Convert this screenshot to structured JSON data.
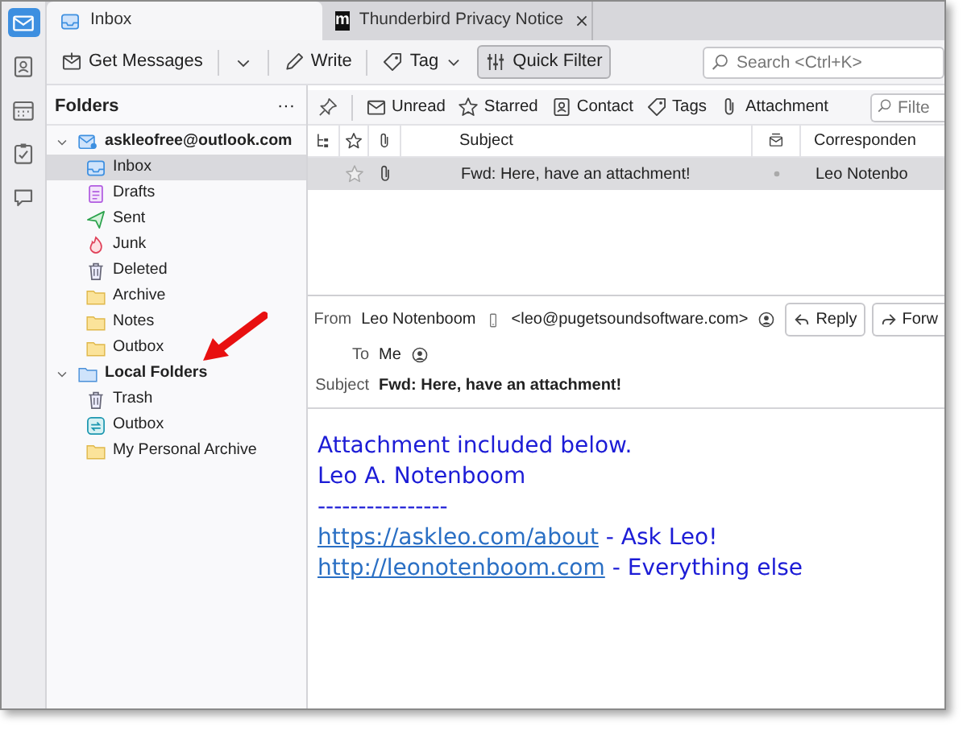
{
  "spaces": [
    {
      "kind": "mail",
      "selected": true
    },
    {
      "kind": "contacts",
      "selected": false
    },
    {
      "kind": "calendar",
      "selected": false
    },
    {
      "kind": "tasks",
      "selected": false
    },
    {
      "kind": "chat",
      "selected": false
    }
  ],
  "tabs": [
    {
      "label": "Inbox",
      "kind": "folder",
      "selected": true,
      "closable": false
    },
    {
      "label": "Thunderbird Privacy Notice",
      "kind": "site",
      "favicon": "m",
      "selected": false,
      "closable": true
    }
  ],
  "toolbar": [
    {
      "kind": "get",
      "label": "Get Messages"
    },
    {
      "kind": "caret"
    },
    {
      "kind": "write",
      "label": "Write"
    },
    {
      "kind": "tag",
      "label": "Tag"
    },
    {
      "kind": "filter",
      "label": "Quick Filter",
      "selected": true
    }
  ],
  "search": {
    "placeholder": "Search <Ctrl+K>"
  },
  "folder_pane": {
    "title": "Folders",
    "menu": "···"
  },
  "accounts": [
    {
      "name": "askleofree@outlook.com",
      "kind": "account",
      "expanded": true,
      "children": [
        {
          "name": "Inbox",
          "kind": "inbox",
          "selected": true
        },
        {
          "name": "Drafts",
          "kind": "drafts",
          "selected": false
        },
        {
          "name": "Sent",
          "kind": "sent",
          "selected": false
        },
        {
          "name": "Junk",
          "kind": "junk",
          "selected": false
        },
        {
          "name": "Deleted",
          "kind": "trash",
          "selected": false
        },
        {
          "name": "Archive",
          "kind": "folder",
          "selected": false
        },
        {
          "name": "Notes",
          "kind": "folder",
          "selected": false
        },
        {
          "name": "Outbox",
          "kind": "folder",
          "selected": false
        }
      ]
    },
    {
      "name": "Local Folders",
      "kind": "local",
      "expanded": true,
      "children": [
        {
          "name": "Trash",
          "kind": "trash",
          "selected": false
        },
        {
          "name": "Outbox",
          "kind": "outbox",
          "selected": false
        },
        {
          "name": "My Personal Archive",
          "kind": "folder",
          "selected": false
        }
      ]
    }
  ],
  "quick_filters": [
    {
      "kind": "unread",
      "label": "Unread"
    },
    {
      "kind": "starred",
      "label": "Starred"
    },
    {
      "kind": "contact",
      "label": "Contact"
    },
    {
      "kind": "tags",
      "label": "Tags"
    },
    {
      "kind": "attachment",
      "label": "Attachment"
    }
  ],
  "filter_field": {
    "placeholder": "Filte"
  },
  "columns": [
    {
      "kind": "thread"
    },
    {
      "kind": "star"
    },
    {
      "kind": "attachment"
    },
    {
      "kind": "text",
      "label": "Subject"
    },
    {
      "kind": "read"
    },
    {
      "kind": "text",
      "label": "Corresponden"
    }
  ],
  "rows": [
    {
      "starred": false,
      "attachment": true,
      "subject": "Fwd: Here, have an attachment!",
      "read": true,
      "correspondent": "Leo Notenbo",
      "selected": true
    }
  ],
  "header": {
    "from": {
      "label": "From",
      "name": "Leo Notenboom",
      "address": "<leo@pugetsoundsoftware.com>"
    },
    "to": {
      "label": "To",
      "name": "Me"
    },
    "subject": {
      "label": "Subject",
      "value": "Fwd: Here, have an attachment!"
    },
    "actions": [
      {
        "kind": "reply",
        "label": "Reply"
      },
      {
        "kind": "forward",
        "label": "Forw"
      }
    ]
  },
  "body": [
    {
      "text": "Attachment included below."
    },
    {
      "text": "Leo A. Notenboom"
    },
    {
      "text": "----------------"
    },
    {
      "link": "https://askleo.com/about",
      "text": "- Ask Leo!"
    },
    {
      "link": "http://leonotenboom.com",
      "text": "- Everything else"
    }
  ]
}
